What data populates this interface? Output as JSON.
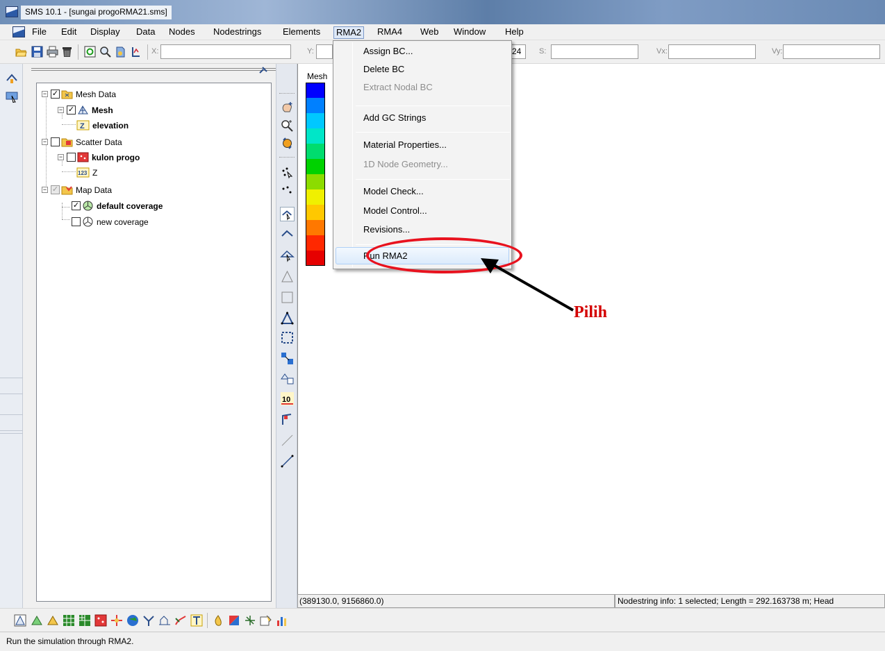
{
  "window": {
    "title": "SMS 10.1 - [sungai progoRMA21.sms]"
  },
  "menubar": {
    "items": [
      {
        "label": "File"
      },
      {
        "label": "Edit"
      },
      {
        "label": "Display"
      },
      {
        "label": "Data"
      },
      {
        "label": "Nodes"
      },
      {
        "label": "Nodestrings"
      },
      {
        "label": "Elements"
      },
      {
        "label": "RMA2",
        "open": true
      },
      {
        "label": "RMA4"
      },
      {
        "label": "Web"
      },
      {
        "label": "Window"
      },
      {
        "label": "Help"
      }
    ]
  },
  "toolbar": {
    "x_label": "X:",
    "x_value": "",
    "y_label": "Y:",
    "y_value": "",
    "z_value_partial": "24",
    "s_label": "S:",
    "s_value": "",
    "vx_label": "Vx:",
    "vx_value": "",
    "vy_label": "Vy:",
    "vy_value": ""
  },
  "tree": {
    "items": [
      {
        "label": "Mesh Data",
        "checked": true,
        "bold": false,
        "icon": "mesh-folder-icon"
      },
      {
        "label": "Mesh",
        "checked": true,
        "bold": true,
        "icon": "mesh-icon"
      },
      {
        "label": "elevation",
        "bold": true,
        "icon": "z-dataset-icon"
      },
      {
        "label": "Scatter Data",
        "checked": false,
        "bold": false,
        "icon": "scatter-folder-icon"
      },
      {
        "label": "kulon progo",
        "checked": false,
        "bold": true,
        "icon": "scatter-set-icon"
      },
      {
        "label": "Z",
        "bold": false,
        "icon": "number-dataset-icon"
      },
      {
        "label": "Map Data",
        "checked": true,
        "grey": true,
        "bold": false,
        "icon": "map-folder-icon"
      },
      {
        "label": "default coverage",
        "checked": true,
        "bold": true,
        "icon": "coverage-icon"
      },
      {
        "label": "new coverage",
        "checked": false,
        "bold": false,
        "icon": "coverage-icon"
      }
    ]
  },
  "legend": {
    "title": "Mesh",
    "colors": [
      "#0000ff",
      "#0080ff",
      "#00c8ff",
      "#00e6c8",
      "#00dc6e",
      "#00d200",
      "#8cdc00",
      "#f0f000",
      "#ffc800",
      "#ff7800",
      "#ff2800",
      "#e60000"
    ]
  },
  "rma2_menu": {
    "items": [
      {
        "label": "Assign BC...",
        "enabled": true
      },
      {
        "label": "Delete BC",
        "enabled": true
      },
      {
        "label": "Extract Nodal BC",
        "enabled": false
      },
      {
        "label": "Add GC Strings",
        "enabled": true
      },
      {
        "label": "Material Properties...",
        "enabled": true
      },
      {
        "label": "1D Node Geometry...",
        "enabled": false
      },
      {
        "label": "Model Check...",
        "enabled": true
      },
      {
        "label": "Model Control...",
        "enabled": true
      },
      {
        "label": "Revisions...",
        "enabled": true
      },
      {
        "label": "Run RMA2",
        "enabled": true,
        "highlighted": true
      }
    ]
  },
  "annotation": {
    "label": "Pilih",
    "color": "#d40000",
    "ellipse_color": "#e8121e"
  },
  "status": {
    "coords": "(389130.0, 9156860.0)",
    "info": "Nodestring info: 1 selected; Length = 292.163738 m; Head",
    "message": "Run the simulation through RMA2."
  }
}
